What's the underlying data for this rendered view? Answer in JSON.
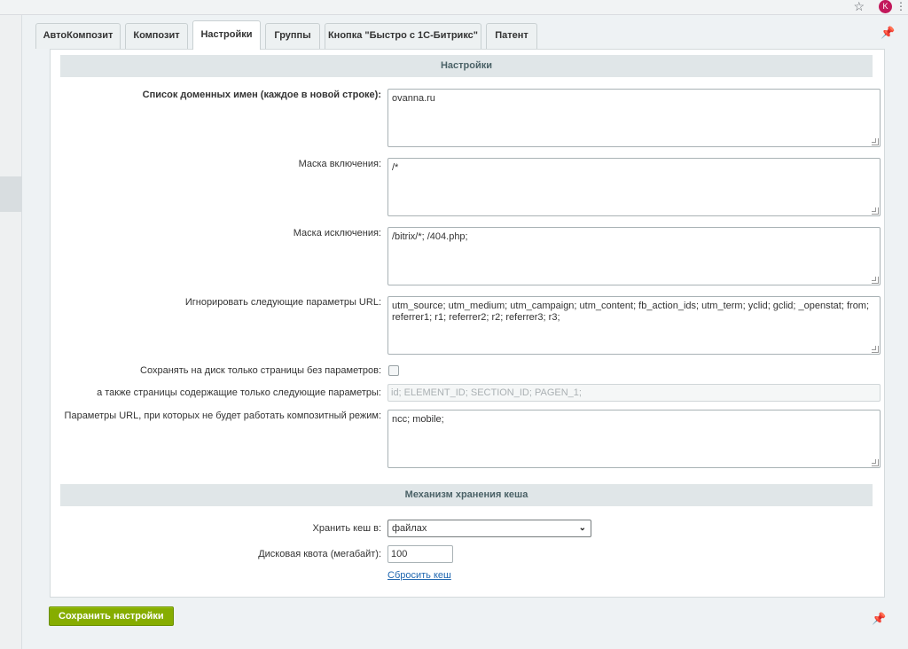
{
  "browser": {
    "star_icon": "star-icon",
    "avatar_letter": "K",
    "menu_icon": "more-vertical-icon"
  },
  "tabs": [
    {
      "label": "АвтоКомпозит"
    },
    {
      "label": "Композит"
    },
    {
      "label": "Настройки",
      "active": true
    },
    {
      "label": "Группы"
    },
    {
      "label": "Кнопка \"Быстро с 1С-Битрикс\""
    },
    {
      "label": "Патент"
    }
  ],
  "sections": {
    "settings": "Настройки",
    "cache": "Механизм хранения кеша"
  },
  "fields": {
    "domains": {
      "label": "Список доменных имен (каждое в новой строке):",
      "value": "ovanna.ru"
    },
    "include_mask": {
      "label": "Маска включения:",
      "value": "/*"
    },
    "exclude_mask": {
      "label": "Маска исключения:",
      "value": "/bitrix/*; /404.php;"
    },
    "ignore_params": {
      "label": "Игнорировать следующие параметры URL:",
      "value": "utm_source; utm_medium; utm_campaign; utm_content; fb_action_ids; utm_term; yclid; gclid; _openstat; from; referrer1; r1; referrer2; r2; referrer3; r3;"
    },
    "save_no_params": {
      "label": "Сохранять на диск только страницы без параметров:",
      "checked": false
    },
    "also_pages": {
      "label": "а также страницы содержащие только следующие параметры:",
      "placeholder": "id; ELEMENT_ID; SECTION_ID; PAGEN_1;"
    },
    "no_composite_params": {
      "label": "Параметры URL, при которых не будет работать композитный режим:",
      "value": "ncc; mobile;"
    },
    "store_cache": {
      "label": "Хранить кеш в:",
      "value": "файлах"
    },
    "disk_quota": {
      "label": "Дисковая квота (мегабайт):",
      "value": "100"
    }
  },
  "reset_cache_link": "Сбросить кеш",
  "save_button": "Сохранить настройки"
}
